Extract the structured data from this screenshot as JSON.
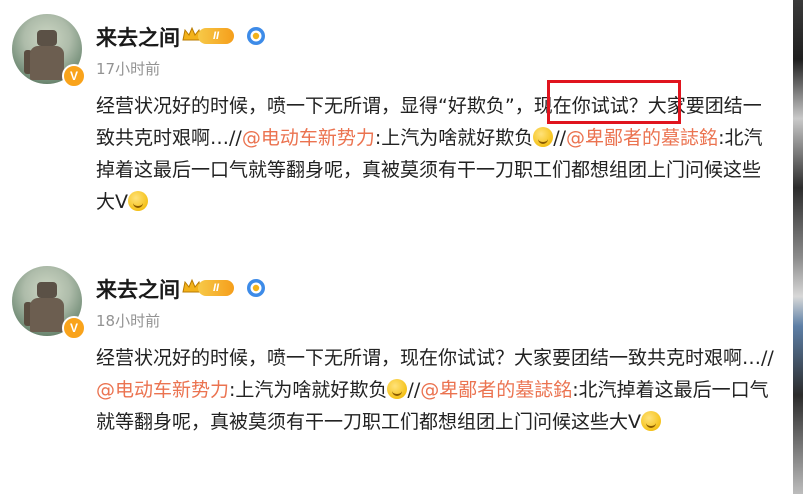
{
  "posts": [
    {
      "username": "来去之间",
      "level_badge": "II",
      "verified_badge": "V",
      "time": "17小时前",
      "content": {
        "t1": "经营状况好的时候，喷一下无所谓，显得“好欺负”，现在你试试？大家要团结一致共克时艰啊…//",
        "m1": "@电动车新势力",
        "t2": ":上汽为啥就好欺负",
        "t3": "//",
        "m2": "@卑鄙者的墓誌銘",
        "t4": ":北汽掉着这最后一口气就等翻身呢，真被莫须有干一刀职工们都想组团上门问候这些大V"
      }
    },
    {
      "username": "来去之间",
      "level_badge": "II",
      "verified_badge": "V",
      "time": "18小时前",
      "content": {
        "t1": "经营状况好的时候，喷一下无所谓，现在你试试？大家要团结一致共克时艰啊…//",
        "m1": "@电动车新势力",
        "t2": ":上汽为啥就好欺负",
        "t3": "//",
        "m2": "@卑鄙者的墓誌銘",
        "t4": ":北汽掉着这最后一口气就等翻身呢，真被莫须有干一刀职工们都想组团上门问候这些大V"
      }
    }
  ],
  "colors": {
    "mention": "#eb7350",
    "highlight_box": "#e0141e",
    "time": "#939393"
  },
  "icons": {
    "level": "crown-icon",
    "verified": "blue-star-icon",
    "emoji_laugh": "laughing-emoji-icon",
    "emoji_shush": "shushing-emoji-icon"
  }
}
